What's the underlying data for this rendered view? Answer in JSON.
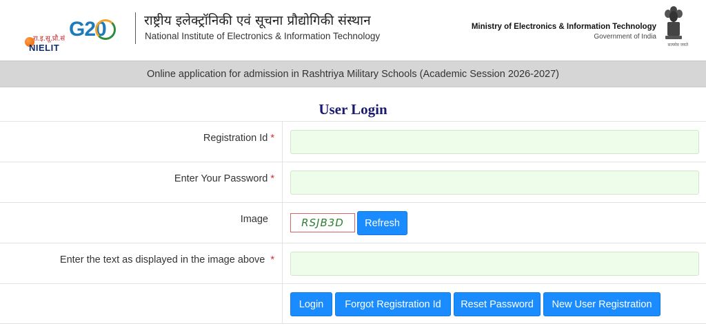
{
  "header": {
    "nielit_hindi_abbr": "रा.इ.सू.प्रौ.सं",
    "nielit_abbr": "NIELIT",
    "g20_text": "G20",
    "hindi_title": "राष्ट्रीय इलेक्ट्रॉनिकी एवं सूचना प्रौद्योगिकी संस्थान",
    "english_title": "National Institute of Electronics & Information Technology",
    "ministry_name": "Ministry of Electronics & Information Technology",
    "ministry_gov": "Government of India",
    "emblem_motto": "सत्यमेव जयते"
  },
  "banner": {
    "text": "Online application for admission in Rashtriya Military Schools (Academic Session 2026-2027)"
  },
  "login": {
    "title": "User Login",
    "registration_label": "Registration Id",
    "password_label": "Enter Your Password",
    "image_label": "Image",
    "captcha_value": "RSJB3D",
    "captcha_input_label": "Enter the text as displayed in the image above",
    "required_marker": "*",
    "registration_value": "",
    "password_value": "",
    "captcha_input_value": ""
  },
  "buttons": {
    "refresh": "Refresh",
    "login": "Login",
    "forgot": "Forgot Registration Id",
    "reset": "Reset Password",
    "new_user": "New User Registration"
  },
  "colors": {
    "primary_button": "#1a8cff",
    "banner_bg": "#d6d6d6",
    "input_bg": "#eefde9",
    "title_color": "#1a1a6e",
    "required_color": "#d32f2f"
  }
}
